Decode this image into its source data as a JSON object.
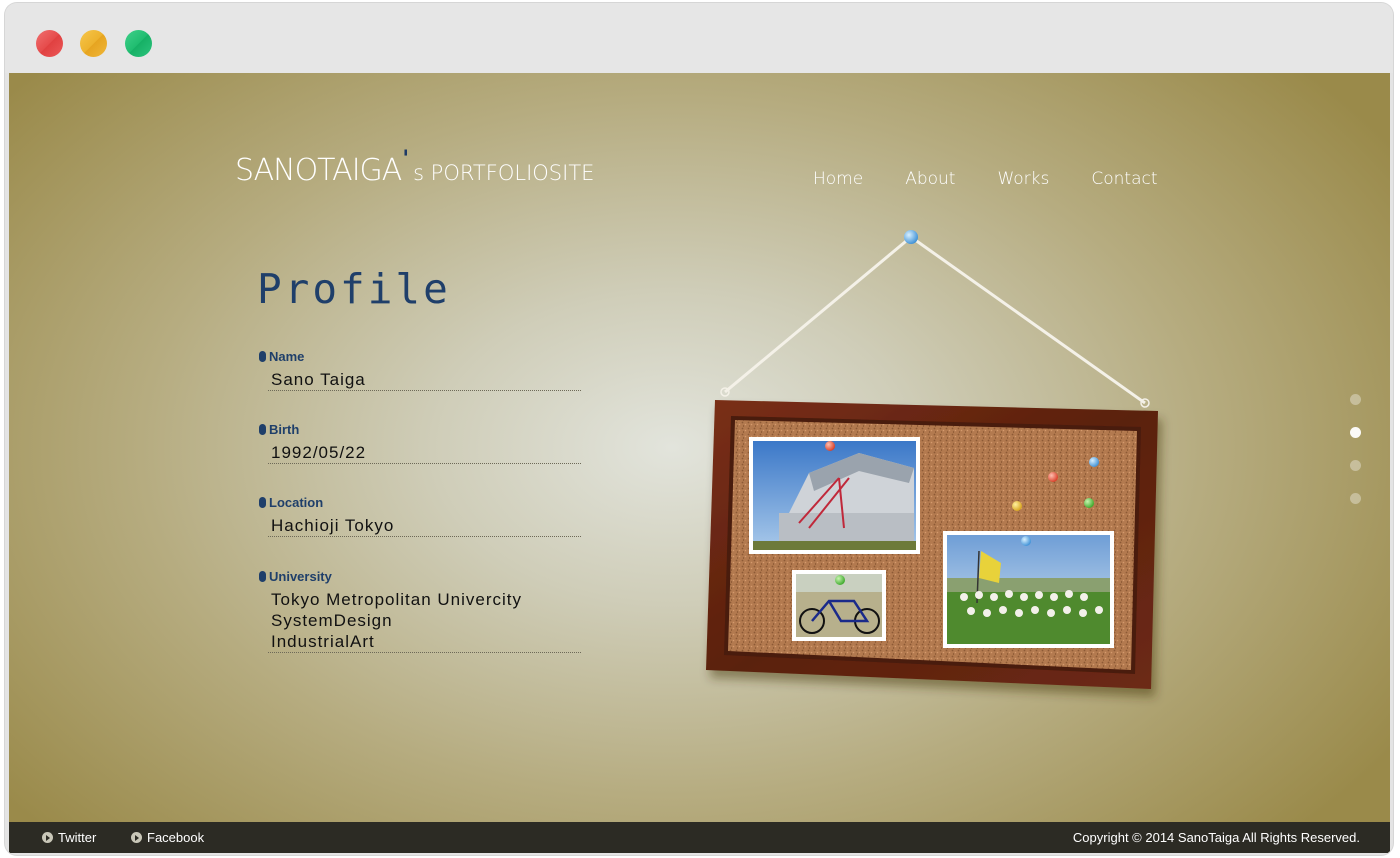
{
  "window": {
    "controls": [
      "close",
      "minimize",
      "maximize"
    ]
  },
  "header": {
    "logo": {
      "main": "SANOTAIGA",
      "apostrophe": "'",
      "suffix": "s PORTFOLIOSITE"
    },
    "nav": [
      "Home",
      "About",
      "Works",
      "Contact"
    ]
  },
  "profile": {
    "title": "Profile",
    "fields": [
      {
        "label": "Name",
        "lines": [
          "Sano Taiga"
        ]
      },
      {
        "label": "Birth",
        "lines": [
          "1992/05/22"
        ]
      },
      {
        "label": "Location",
        "lines": [
          "Hachioji Tokyo"
        ]
      },
      {
        "label": "University",
        "lines": [
          "Tokyo Metropolitan Univercity",
          "SystemDesign",
          "IndustrialArt"
        ]
      }
    ]
  },
  "pager": {
    "count": 4,
    "active_index": 1
  },
  "footer": {
    "twitter": "Twitter",
    "facebook": "Facebook",
    "copyright": "Copyright © 2014 SanoTaiga All Rights Reserved."
  },
  "colors": {
    "accent_navy": "#1f3f6a",
    "frame_wood": "#6a2a14",
    "cork": "#b5784e",
    "footer_bg": "#2c2b24"
  }
}
